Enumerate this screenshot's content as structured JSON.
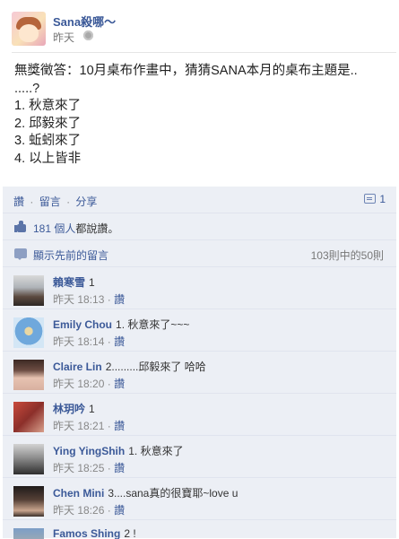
{
  "post": {
    "author": "Sana殺哪～",
    "time": "昨天",
    "lines": [
      "無獎徵答：10月桌布作畫中，猜猜SANA本月的桌布主題是..",
      ".....?",
      "1. 秋意來了",
      "2. 邱毅來了",
      "3. 蚯蚓來了",
      "4. 以上皆非"
    ]
  },
  "actions": {
    "like": "讚",
    "comment": "留言",
    "share": "分享",
    "comment_count": "1"
  },
  "likes": {
    "count_link": "181 個人",
    "suffix": "都說讚。"
  },
  "previous": {
    "label": "顯示先前的留言",
    "count": "103則中的50則"
  },
  "comments": [
    {
      "name": "賴寒雪",
      "text": "1",
      "time": "昨天 18:13",
      "like": "讚"
    },
    {
      "name": "Emily Chou",
      "text": "1. 秋意來了~~~",
      "time": "昨天 18:14",
      "like": "讚"
    },
    {
      "name": "Claire Lin",
      "text": "2.........邱毅來了 哈哈",
      "time": "昨天 18:20",
      "like": "讚"
    },
    {
      "name": "林玥吟",
      "text": "1",
      "time": "昨天 18:21",
      "like": "讚"
    },
    {
      "name": "Ying YingShih",
      "text": "1. 秋意來了",
      "time": "昨天 18:25",
      "like": "讚"
    },
    {
      "name": "Chen Mini",
      "text": "3....sana真的很寶耶~love u",
      "time": "昨天 18:26",
      "like": "讚"
    },
    {
      "name": "Famos Shing",
      "text": "2 !"
    }
  ],
  "separator_dot": "·"
}
